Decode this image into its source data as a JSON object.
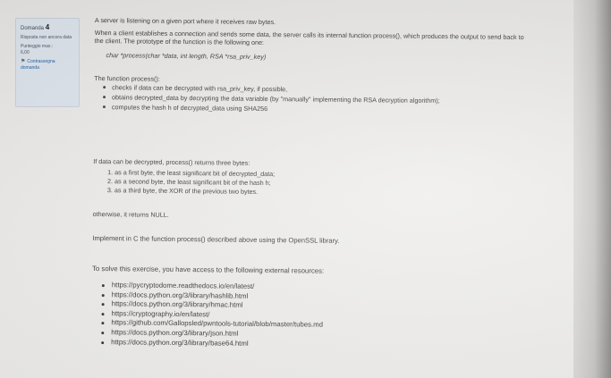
{
  "question_info": {
    "heading": "Domanda",
    "number": "4",
    "status": "Risposta non ancora data",
    "score_label": "Punteggio max.:",
    "score_value": "6,00",
    "flag_label": "Contrassegna domanda",
    "flag_icon": "flag-icon"
  },
  "question": {
    "intro": "A server is listening on a given port where it receives raw bytes.",
    "description": "When a client establishes a connection and sends some data, the server calls its internal function process(), which produces the output to send back to the client. The prototype of the function is the following one:",
    "prototype": "char *process(char *data, int length, RSA *rsa_priv_key)",
    "function_heading": "The function process():",
    "function_points": [
      "checks if data can be decrypted with rsa_priv_key, if possible,",
      "obtains decrypted_data by decrypting the data variable (by \"manually\" implementing the RSA decryption algorithm);",
      "computes the hash h of decrypted_data using SHA256"
    ],
    "return_intro": "If data can be decrypted, process() returns three bytes:",
    "return_items": [
      "as a first byte, the least significant bit of decrypted_data;",
      "as a second byte, the least significant bit of the hash h;",
      "as a third byte, the XOR of the previous two bytes."
    ],
    "otherwise": "otherwise, it returns NULL.",
    "task": "Implement in C the function process() described above using the OpenSSL library.",
    "resources_intro": "To solve this exercise, you have access to the following external resources:",
    "resources": [
      "https://pycryptodome.readthedocs.io/en/latest/",
      "https://docs.python.org/3/library/hashlib.html",
      "https://docs.python.org/3/library/hmac.html",
      "https://cryptography.io/en/latest/",
      "https://github.com/Gallopsled/pwntools-tutorial/blob/master/tubes.md",
      "https://docs.python.org/3/library/json.html",
      "https://docs.python.org/3/library/base64.html"
    ]
  }
}
